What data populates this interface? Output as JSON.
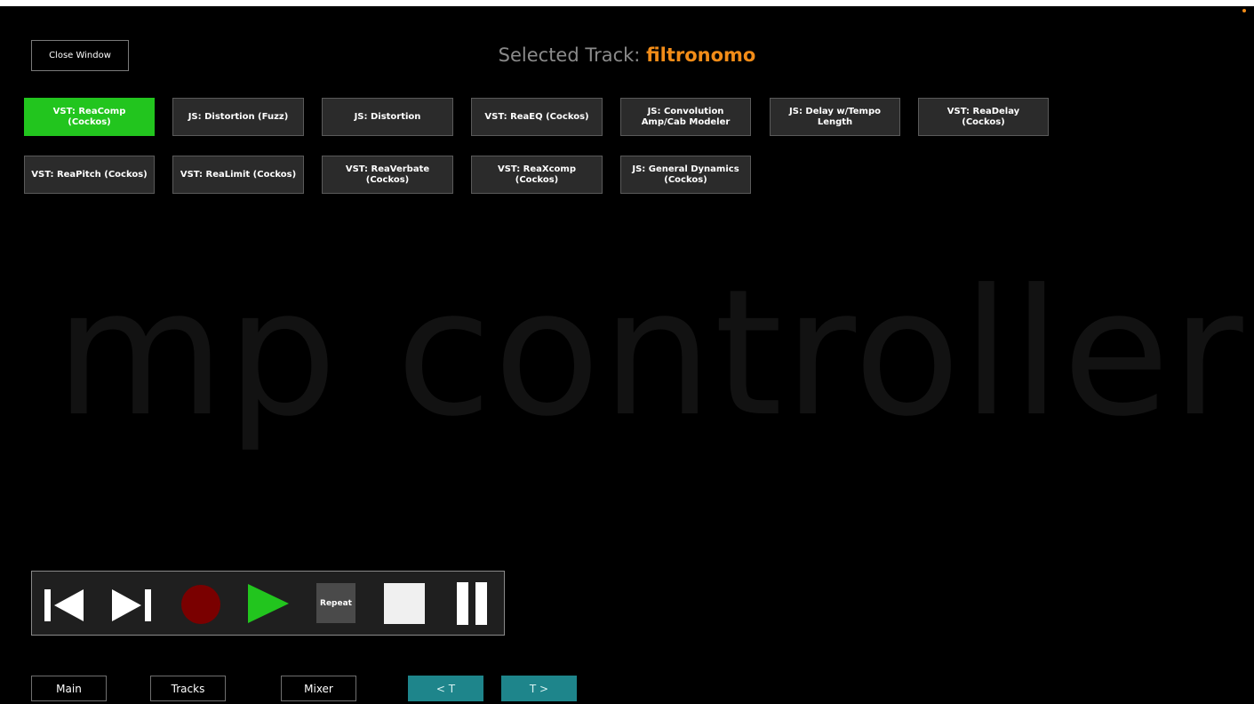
{
  "header": {
    "close_label": "Close Window",
    "title_prefix": "Selected Track:",
    "track_name": "filtronomo"
  },
  "watermark": "mp controller",
  "fx_rows": [
    [
      {
        "label": "VST: ReaComp (Cockos)",
        "active": true
      },
      {
        "label": "JS: Distortion (Fuzz)",
        "active": false
      },
      {
        "label": "JS: Distortion",
        "active": false
      },
      {
        "label": "VST: ReaEQ (Cockos)",
        "active": false
      },
      {
        "label": "JS: Convolution Amp/Cab Modeler",
        "active": false
      },
      {
        "label": "JS: Delay w/Tempo Length",
        "active": false
      },
      {
        "label": "VST: ReaDelay (Cockos)",
        "active": false
      }
    ],
    [
      {
        "label": "VST: ReaPitch (Cockos)",
        "active": false
      },
      {
        "label": "VST: ReaLimit (Cockos)",
        "active": false
      },
      {
        "label": "VST: ReaVerbate (Cockos)",
        "active": false
      },
      {
        "label": "VST: ReaXcomp (Cockos)",
        "active": false
      },
      {
        "label": "JS: General Dynamics (Cockos)",
        "active": false
      }
    ]
  ],
  "transport": {
    "repeat_label": "Repeat",
    "icons": [
      "skip-back-icon",
      "skip-forward-icon",
      "record-icon",
      "play-icon",
      "stop-icon",
      "pause-icon"
    ]
  },
  "nav": [
    {
      "label": "Main",
      "name": "main"
    },
    {
      "label": "Tracks",
      "name": "tracks"
    },
    {
      "label": "Mixer",
      "name": "mixer"
    },
    {
      "label": "< T",
      "name": "prev-track"
    },
    {
      "label": "T >",
      "name": "next-track"
    }
  ],
  "colors": {
    "accent_track": "#f28c18",
    "fx_active": "#22c51e",
    "fx_inactive": "#2b2b2b",
    "record": "#7a0000",
    "play": "#22c51e",
    "nav_teal": "#1e858b",
    "watermark": "#121212",
    "corner_dot": "#f28c18"
  }
}
